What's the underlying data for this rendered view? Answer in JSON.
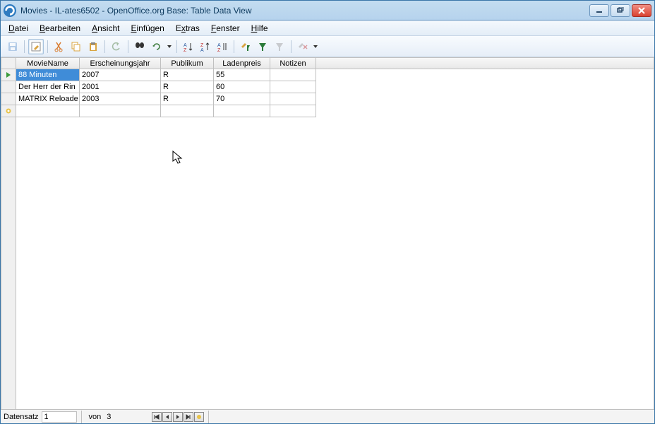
{
  "titlebar": {
    "text": "Movies - IL-ates6502 - OpenOffice.org Base: Table Data View"
  },
  "menu": {
    "file": "Datei",
    "file_u": "D",
    "edit": "Bearbeiten",
    "edit_u": "B",
    "view": "Ansicht",
    "view_u": "A",
    "insert": "Einfügen",
    "insert_u": "E",
    "extras": "Extras",
    "extras_u": "x",
    "window": "Fenster",
    "window_u": "F",
    "help": "Hilfe",
    "help_u": "H"
  },
  "columns": [
    "MovieName",
    "Erscheinungsjahr",
    "Publikum",
    "Ladenpreis",
    "Notizen"
  ],
  "rows": [
    {
      "MovieName": "88 Minuten",
      "Erscheinungsjahr": "2007",
      "Publikum": "R",
      "Ladenpreis": "55",
      "Notizen": ""
    },
    {
      "MovieName": "Der Herr der Rin",
      "Erscheinungsjahr": "2001",
      "Publikum": "R",
      "Ladenpreis": "60",
      "Notizen": ""
    },
    {
      "MovieName": "MATRIX Reloade",
      "Erscheinungsjahr": "2003",
      "Publikum": "R",
      "Ladenpreis": "70",
      "Notizen": ""
    }
  ],
  "statusbar": {
    "record_label": "Datensatz",
    "current": "1",
    "of_label": "von",
    "total": "3"
  }
}
